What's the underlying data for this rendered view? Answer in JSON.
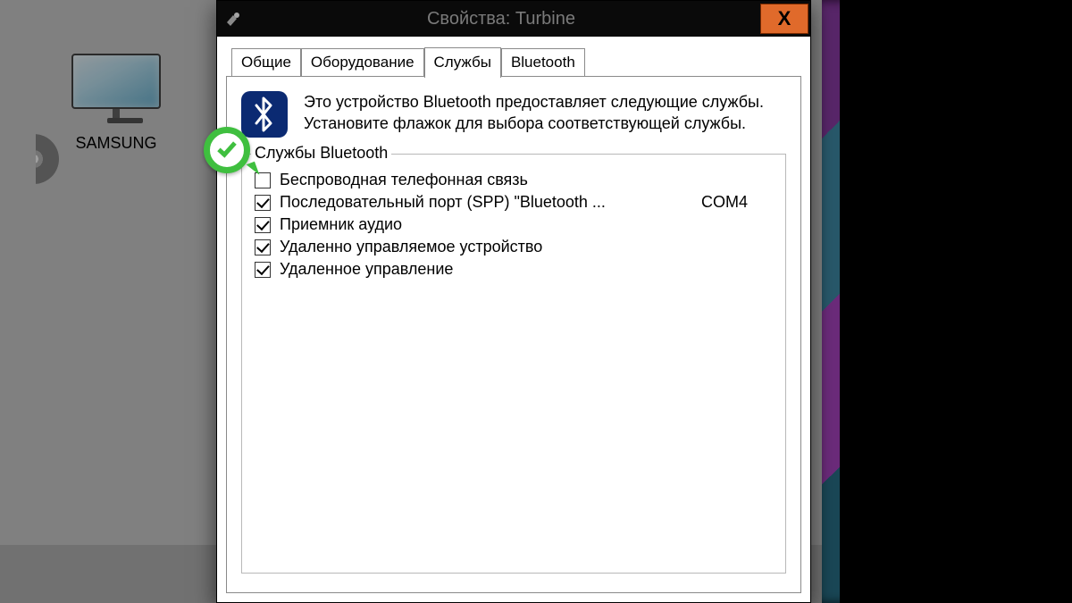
{
  "desktop": {
    "icon_label": "SAMSUNG"
  },
  "dialog": {
    "title": "Свойства: Turbine",
    "close_glyph": "X",
    "tabs": [
      {
        "label": "Общие"
      },
      {
        "label": "Оборудование"
      },
      {
        "label": "Службы"
      },
      {
        "label": "Bluetooth"
      }
    ],
    "intro_line1": "Это устройство Bluetooth предоставляет следующие службы.",
    "intro_line2": "Установите флажок для выбора соответствующей службы.",
    "fieldset_legend": "Службы Bluetooth",
    "services": [
      {
        "checked": false,
        "label": "Беспроводная телефонная связь",
        "extra": ""
      },
      {
        "checked": true,
        "label": "Последовательный порт (SPP) \"Bluetooth ...",
        "extra": "COM4"
      },
      {
        "checked": true,
        "label": "Приемник аудио",
        "extra": ""
      },
      {
        "checked": true,
        "label": "Удаленно управляемое устройство",
        "extra": ""
      },
      {
        "checked": true,
        "label": "Удаленное управление",
        "extra": ""
      }
    ]
  }
}
